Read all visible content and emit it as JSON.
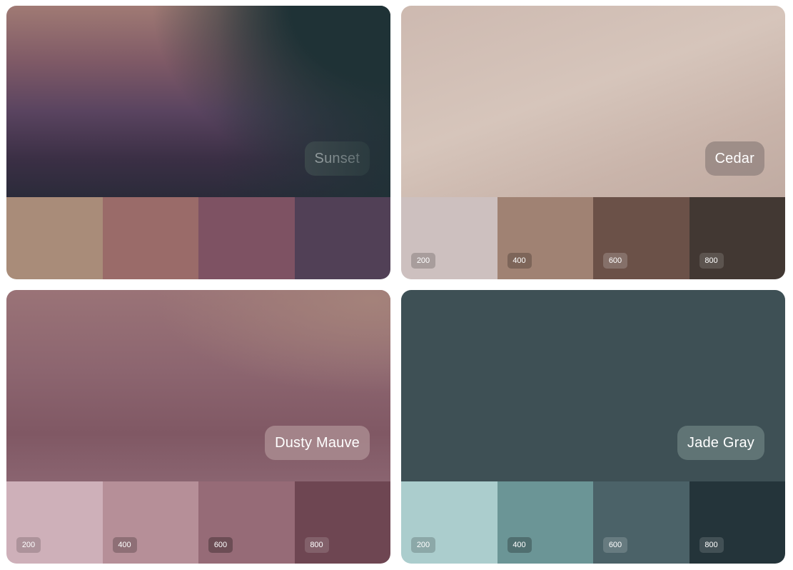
{
  "palettes": [
    {
      "name": "Sunset",
      "pill_color": "rgba(90,100,100,0.72)",
      "swatches": [
        {
          "label": "",
          "color": "#a98c79"
        },
        {
          "label": "",
          "color": "#9a6b69"
        },
        {
          "label": "",
          "color": "#7e5263"
        },
        {
          "label": "",
          "color": "#514056"
        }
      ]
    },
    {
      "name": "Cedar",
      "pill_color": "rgba(150,135,130,0.85)",
      "swatches": [
        {
          "label": "200",
          "color": "#cdc0bf"
        },
        {
          "label": "400",
          "color": "#a08273"
        },
        {
          "label": "600",
          "color": "#6b5148"
        },
        {
          "label": "800",
          "color": "#423833"
        }
      ]
    },
    {
      "name": "Dusty Mauve",
      "pill_color": "rgba(175,145,150,0.75)",
      "swatches": [
        {
          "label": "200",
          "color": "#ceb0b9"
        },
        {
          "label": "400",
          "color": "#b68f98"
        },
        {
          "label": "600",
          "color": "#966b77"
        },
        {
          "label": "800",
          "color": "#6e4652"
        }
      ]
    },
    {
      "name": "Jade Gray",
      "pill_color": "rgba(105,125,125,0.8)",
      "swatches": [
        {
          "label": "200",
          "color": "#abcdcd"
        },
        {
          "label": "400",
          "color": "#6b9596"
        },
        {
          "label": "600",
          "color": "#4b6268"
        },
        {
          "label": "800",
          "color": "#24343a"
        }
      ]
    }
  ]
}
